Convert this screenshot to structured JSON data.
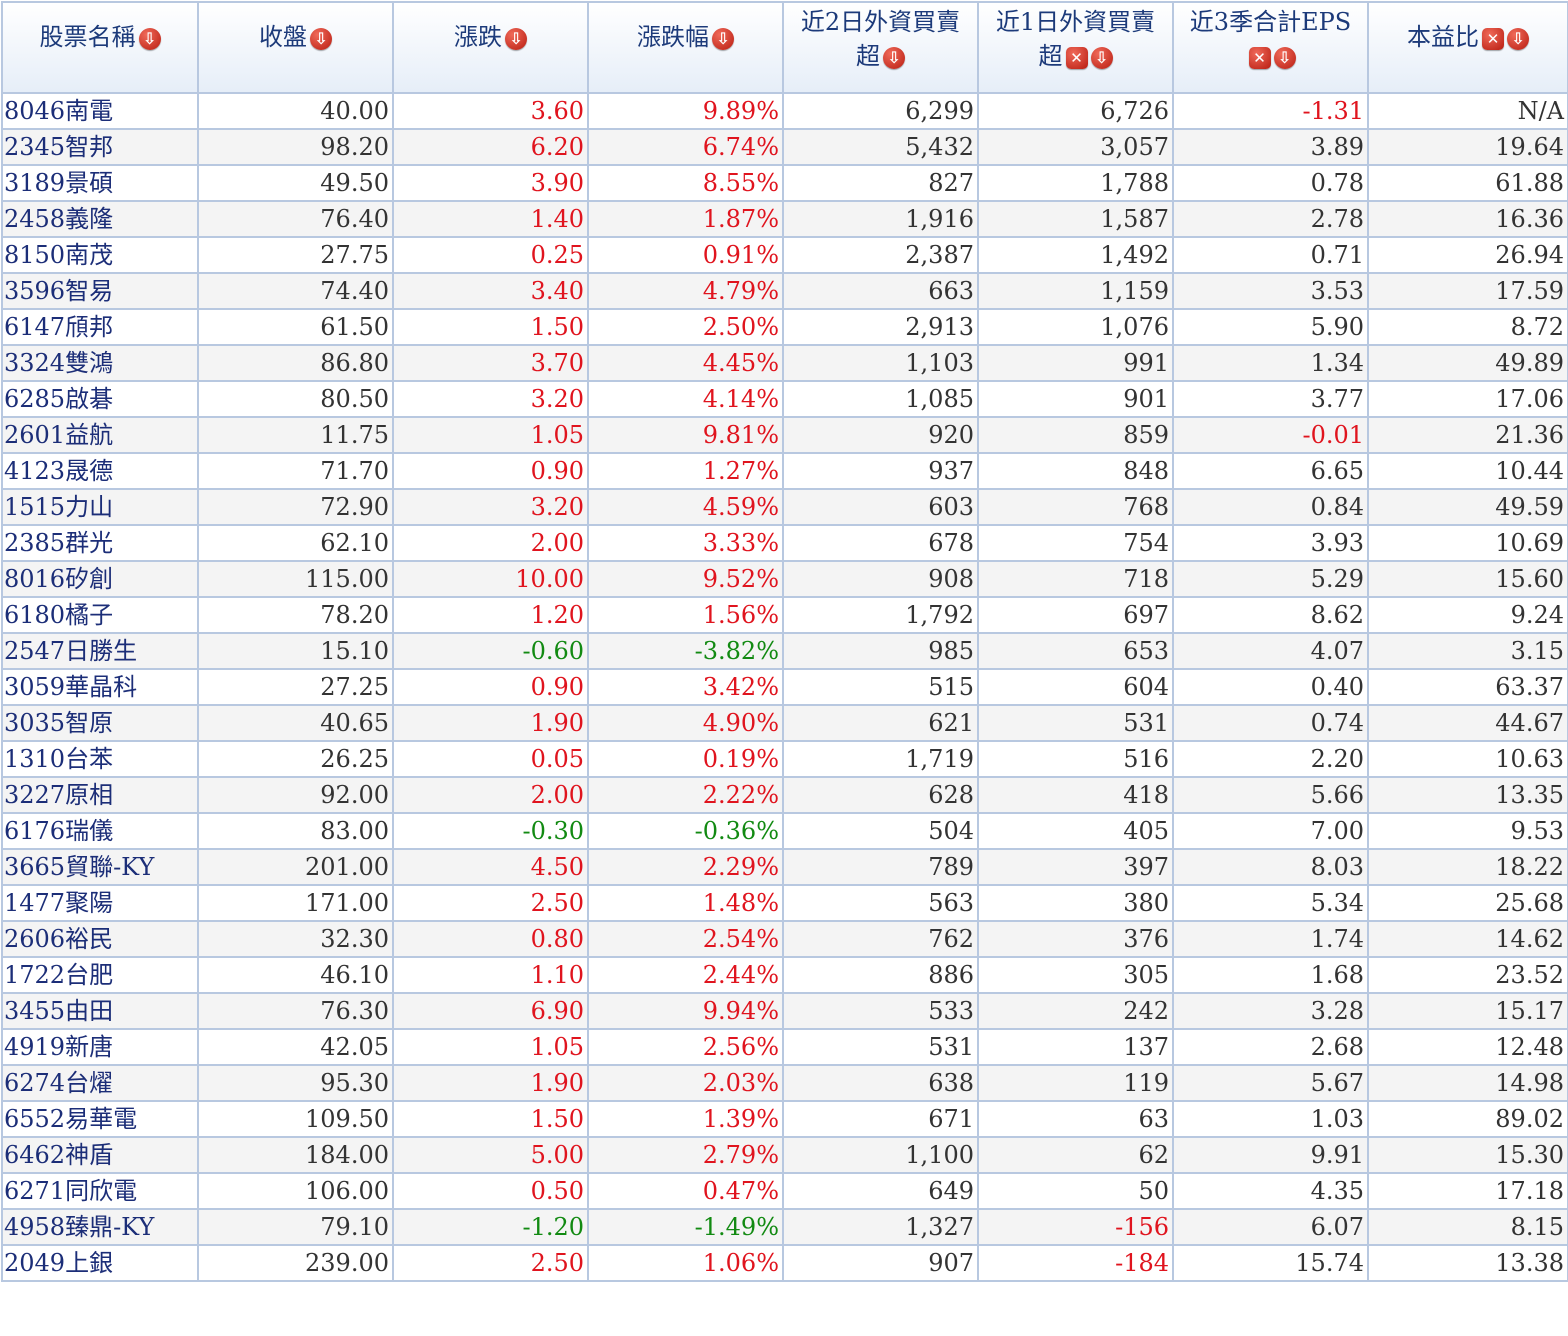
{
  "colors": {
    "up": "#e0141e",
    "down": "#128a12",
    "header_text": "#1c3a7a",
    "name_text": "#1c2e78"
  },
  "headers": {
    "name": "股票名稱",
    "close": "收盤",
    "change": "漲跌",
    "pct": "漲跌幅",
    "f2_line1": "近2日外資買賣",
    "f2_line2": "超",
    "f1_line1": "近1日外資買賣",
    "f1_line2": "超",
    "eps": "近3季合計EPS",
    "pe": "本益比"
  },
  "icons": {
    "sort": "sort-down-icon",
    "remove": "remove-column-icon"
  },
  "rows": [
    {
      "name": "8046南電",
      "close": "40.00",
      "change": "3.60",
      "pct": "9.89%",
      "f2": "6,299",
      "f1": "6,726",
      "eps": "-1.31",
      "pe": "N/A"
    },
    {
      "name": "2345智邦",
      "close": "98.20",
      "change": "6.20",
      "pct": "6.74%",
      "f2": "5,432",
      "f1": "3,057",
      "eps": "3.89",
      "pe": "19.64"
    },
    {
      "name": "3189景碩",
      "close": "49.50",
      "change": "3.90",
      "pct": "8.55%",
      "f2": "827",
      "f1": "1,788",
      "eps": "0.78",
      "pe": "61.88"
    },
    {
      "name": "2458義隆",
      "close": "76.40",
      "change": "1.40",
      "pct": "1.87%",
      "f2": "1,916",
      "f1": "1,587",
      "eps": "2.78",
      "pe": "16.36"
    },
    {
      "name": "8150南茂",
      "close": "27.75",
      "change": "0.25",
      "pct": "0.91%",
      "f2": "2,387",
      "f1": "1,492",
      "eps": "0.71",
      "pe": "26.94"
    },
    {
      "name": "3596智易",
      "close": "74.40",
      "change": "3.40",
      "pct": "4.79%",
      "f2": "663",
      "f1": "1,159",
      "eps": "3.53",
      "pe": "17.59"
    },
    {
      "name": "6147頎邦",
      "close": "61.50",
      "change": "1.50",
      "pct": "2.50%",
      "f2": "2,913",
      "f1": "1,076",
      "eps": "5.90",
      "pe": "8.72"
    },
    {
      "name": "3324雙鴻",
      "close": "86.80",
      "change": "3.70",
      "pct": "4.45%",
      "f2": "1,103",
      "f1": "991",
      "eps": "1.34",
      "pe": "49.89"
    },
    {
      "name": "6285啟碁",
      "close": "80.50",
      "change": "3.20",
      "pct": "4.14%",
      "f2": "1,085",
      "f1": "901",
      "eps": "3.77",
      "pe": "17.06"
    },
    {
      "name": "2601益航",
      "close": "11.75",
      "change": "1.05",
      "pct": "9.81%",
      "f2": "920",
      "f1": "859",
      "eps": "-0.01",
      "pe": "21.36"
    },
    {
      "name": "4123晟德",
      "close": "71.70",
      "change": "0.90",
      "pct": "1.27%",
      "f2": "937",
      "f1": "848",
      "eps": "6.65",
      "pe": "10.44"
    },
    {
      "name": "1515力山",
      "close": "72.90",
      "change": "3.20",
      "pct": "4.59%",
      "f2": "603",
      "f1": "768",
      "eps": "0.84",
      "pe": "49.59"
    },
    {
      "name": "2385群光",
      "close": "62.10",
      "change": "2.00",
      "pct": "3.33%",
      "f2": "678",
      "f1": "754",
      "eps": "3.93",
      "pe": "10.69"
    },
    {
      "name": "8016矽創",
      "close": "115.00",
      "change": "10.00",
      "pct": "9.52%",
      "f2": "908",
      "f1": "718",
      "eps": "5.29",
      "pe": "15.60"
    },
    {
      "name": "6180橘子",
      "close": "78.20",
      "change": "1.20",
      "pct": "1.56%",
      "f2": "1,792",
      "f1": "697",
      "eps": "8.62",
      "pe": "9.24"
    },
    {
      "name": "2547日勝生",
      "close": "15.10",
      "change": "-0.60",
      "pct": "-3.82%",
      "f2": "985",
      "f1": "653",
      "eps": "4.07",
      "pe": "3.15"
    },
    {
      "name": "3059華晶科",
      "close": "27.25",
      "change": "0.90",
      "pct": "3.42%",
      "f2": "515",
      "f1": "604",
      "eps": "0.40",
      "pe": "63.37"
    },
    {
      "name": "3035智原",
      "close": "40.65",
      "change": "1.90",
      "pct": "4.90%",
      "f2": "621",
      "f1": "531",
      "eps": "0.74",
      "pe": "44.67"
    },
    {
      "name": "1310台苯",
      "close": "26.25",
      "change": "0.05",
      "pct": "0.19%",
      "f2": "1,719",
      "f1": "516",
      "eps": "2.20",
      "pe": "10.63"
    },
    {
      "name": "3227原相",
      "close": "92.00",
      "change": "2.00",
      "pct": "2.22%",
      "f2": "628",
      "f1": "418",
      "eps": "5.66",
      "pe": "13.35"
    },
    {
      "name": "6176瑞儀",
      "close": "83.00",
      "change": "-0.30",
      "pct": "-0.36%",
      "f2": "504",
      "f1": "405",
      "eps": "7.00",
      "pe": "9.53"
    },
    {
      "name": "3665貿聯-KY",
      "close": "201.00",
      "change": "4.50",
      "pct": "2.29%",
      "f2": "789",
      "f1": "397",
      "eps": "8.03",
      "pe": "18.22"
    },
    {
      "name": "1477聚陽",
      "close": "171.00",
      "change": "2.50",
      "pct": "1.48%",
      "f2": "563",
      "f1": "380",
      "eps": "5.34",
      "pe": "25.68"
    },
    {
      "name": "2606裕民",
      "close": "32.30",
      "change": "0.80",
      "pct": "2.54%",
      "f2": "762",
      "f1": "376",
      "eps": "1.74",
      "pe": "14.62"
    },
    {
      "name": "1722台肥",
      "close": "46.10",
      "change": "1.10",
      "pct": "2.44%",
      "f2": "886",
      "f1": "305",
      "eps": "1.68",
      "pe": "23.52"
    },
    {
      "name": "3455由田",
      "close": "76.30",
      "change": "6.90",
      "pct": "9.94%",
      "f2": "533",
      "f1": "242",
      "eps": "3.28",
      "pe": "15.17"
    },
    {
      "name": "4919新唐",
      "close": "42.05",
      "change": "1.05",
      "pct": "2.56%",
      "f2": "531",
      "f1": "137",
      "eps": "2.68",
      "pe": "12.48"
    },
    {
      "name": "6274台燿",
      "close": "95.30",
      "change": "1.90",
      "pct": "2.03%",
      "f2": "638",
      "f1": "119",
      "eps": "5.67",
      "pe": "14.98"
    },
    {
      "name": "6552易華電",
      "close": "109.50",
      "change": "1.50",
      "pct": "1.39%",
      "f2": "671",
      "f1": "63",
      "eps": "1.03",
      "pe": "89.02"
    },
    {
      "name": "6462神盾",
      "close": "184.00",
      "change": "5.00",
      "pct": "2.79%",
      "f2": "1,100",
      "f1": "62",
      "eps": "9.91",
      "pe": "15.30"
    },
    {
      "name": "6271同欣電",
      "close": "106.00",
      "change": "0.50",
      "pct": "0.47%",
      "f2": "649",
      "f1": "50",
      "eps": "4.35",
      "pe": "17.18"
    },
    {
      "name": "4958臻鼎-KY",
      "close": "79.10",
      "change": "-1.20",
      "pct": "-1.49%",
      "f2": "1,327",
      "f1": "-156",
      "eps": "6.07",
      "pe": "8.15"
    },
    {
      "name": "2049上銀",
      "close": "239.00",
      "change": "2.50",
      "pct": "1.06%",
      "f2": "907",
      "f1": "-184",
      "eps": "15.74",
      "pe": "13.38"
    }
  ]
}
